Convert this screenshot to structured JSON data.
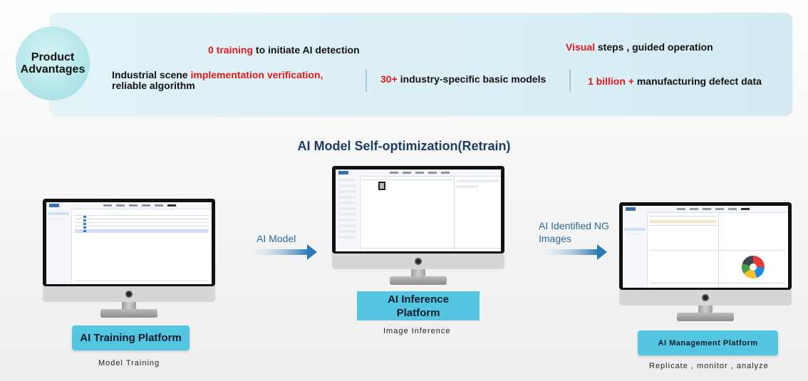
{
  "advantages": {
    "title_line1": "Product",
    "title_line2": "Advantages",
    "item1": {
      "highlight": "0 training",
      "text": " to initiate AI detection"
    },
    "item2": {
      "highlight": "Visual",
      "text": " steps , guided operation"
    },
    "item3": {
      "prefix": "Industrial scene ",
      "highlight": "implementation verification,",
      "line2": "reliable algorithm"
    },
    "item4": {
      "highlight": "30+",
      "text": " industry-specific basic models"
    },
    "item5": {
      "highlight": "1 billion +",
      "text": " manufacturing defect data"
    }
  },
  "flow": {
    "title": "AI Model Self-optimization(Retrain)",
    "arrow1_label": "AI Model",
    "arrow2_label_line1": "AI Identified NG",
    "arrow2_label_line2": "Images"
  },
  "platforms": {
    "training": {
      "label": "AI Training Platform",
      "caption": "Model Training"
    },
    "inference": {
      "label_line1": "AI Inference",
      "label_line2": "Platform",
      "caption": "Image Inference"
    },
    "management": {
      "label": "AI Management Platform",
      "caption": "Replicate , monitor , analyze"
    }
  },
  "colors": {
    "accent_red": "#e0181b",
    "label_cyan": "#55c6e2",
    "panel_bg": "#dbeff6",
    "arrow_blue": "#2b7ab8"
  },
  "pie_chart": {
    "type": "pie",
    "values": [
      25,
      20,
      20,
      15,
      20
    ],
    "colors": [
      "#e53935",
      "#1e88e5",
      "#fbc02d",
      "#43a047",
      "#37474f"
    ]
  }
}
